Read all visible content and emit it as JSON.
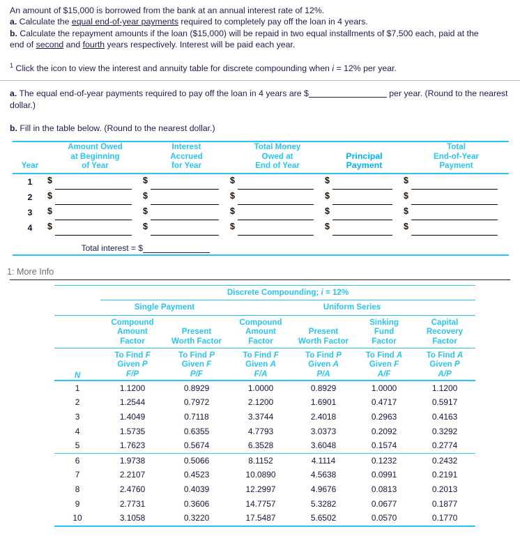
{
  "problem": {
    "intro": "An amount of $15,000 is borrowed from the bank at an annual interest rate of 12%.",
    "part_a_label": "a.",
    "part_a_pre": " Calculate the ",
    "part_a_underline": "equal end-of-year payments",
    "part_a_post": " required to completely pay off the loan in 4 years.",
    "part_b_label": "b.",
    "part_b_line1": " Calculate the repayment amounts if the loan ($15,000) will be repaid in two equal  installments of $7,500 each, paid at the",
    "part_b_line2_pre": "end of ",
    "part_b_u1": "second",
    "part_b_mid": " and ",
    "part_b_u2": "fourth",
    "part_b_line2_post": " years respectively. Interest will be paid each year."
  },
  "footnote": {
    "marker": "1",
    "text_pre": " Click the icon to view the interest and annuity table for discrete compounding when ",
    "i_symbol": "i",
    "text_post": " = 12% per year."
  },
  "answers": {
    "a_label": "a.",
    "a_text_pre": " The equal end-of-year payments required to pay off the loan in 4 years are $",
    "a_text_mid": " per year. ",
    "a_paren": "(Round to the nearest dollar.)",
    "b_label": "b.",
    "b_text": " Fill in the table below. ",
    "b_paren": "(Round to the nearest dollar.)"
  },
  "fill_table": {
    "headers": [
      "Year",
      "Amount Owed\nat Beginning\nof Year",
      "Interest\nAccrued\nfor Year",
      "Total Money\nOwed at\nEnd of Year",
      "Principal\nPayment",
      "Total\nEnd-of-Year\nPayment"
    ],
    "header_lines": {
      "year": [
        "Year"
      ],
      "amount_owed": [
        "Amount Owed",
        "at Beginning",
        "of Year"
      ],
      "interest": [
        "Interest",
        "Accrued",
        "for Year"
      ],
      "total_money": [
        "Total Money",
        "Owed at",
        "End of Year"
      ],
      "principal": [
        "Principal",
        "Payment"
      ],
      "total_payment": [
        "Total",
        "End-of-Year",
        "Payment"
      ]
    },
    "rows": [
      {
        "year": "1",
        "values": [
          "",
          "",
          "",
          "",
          ""
        ]
      },
      {
        "year": "2",
        "values": [
          "",
          "",
          "",
          "",
          ""
        ]
      },
      {
        "year": "3",
        "values": [
          "",
          "",
          "",
          "",
          ""
        ]
      },
      {
        "year": "4",
        "values": [
          "",
          "",
          "",
          "",
          ""
        ]
      }
    ],
    "currency_symbol": "$",
    "total_label": "Total interest = $",
    "total_value": ""
  },
  "more_info": {
    "label": "1: More Info"
  },
  "chart_data": {
    "type": "table",
    "title": "Discrete Compounding;",
    "title_i": "i",
    "title_rate": " = 12%",
    "group_headers": [
      "Single Payment",
      "Uniform Series"
    ],
    "column_titles": [
      [
        "Compound",
        "Amount",
        "Factor"
      ],
      [
        "Present",
        "Worth Factor"
      ],
      [
        "Compound",
        "Amount",
        "Factor"
      ],
      [
        "Present",
        "Worth Factor"
      ],
      [
        "Sinking",
        "Fund",
        "Factor"
      ],
      [
        "Capital",
        "Recovery",
        "Factor"
      ]
    ],
    "find_given": [
      [
        "To Find ",
        "F",
        "Given ",
        "P",
        "F/P"
      ],
      [
        "To Find ",
        "P",
        "Given ",
        "F",
        "P/F"
      ],
      [
        "To Find ",
        "F",
        "Given ",
        "A",
        "F/A"
      ],
      [
        "To Find ",
        "P",
        "Given ",
        "A",
        "P/A"
      ],
      [
        "To Find ",
        "A",
        "Given ",
        "F",
        "A/F"
      ],
      [
        "To Find ",
        "A",
        "Given ",
        "P",
        "A/P"
      ]
    ],
    "n_label": "N",
    "categories": [
      "1",
      "2",
      "3",
      "4",
      "5",
      "6",
      "7",
      "8",
      "9",
      "10"
    ],
    "series": [
      {
        "name": "F/P",
        "values": [
          "1.1200",
          "1.2544",
          "1.4049",
          "1.5735",
          "1.7623",
          "1.9738",
          "2.2107",
          "2.4760",
          "2.7731",
          "3.1058"
        ]
      },
      {
        "name": "P/F",
        "values": [
          "0.8929",
          "0.7972",
          "0.7118",
          "0.6355",
          "0.5674",
          "0.5066",
          "0.4523",
          "0.4039",
          "0.3606",
          "0.3220"
        ]
      },
      {
        "name": "F/A",
        "values": [
          "1.0000",
          "2.1200",
          "3.3744",
          "4.7793",
          "6.3528",
          "8.1152",
          "10.0890",
          "12.2997",
          "14.7757",
          "17.5487"
        ]
      },
      {
        "name": "P/A",
        "values": [
          "0.8929",
          "1.6901",
          "2.4018",
          "3.0373",
          "3.6048",
          "4.1114",
          "4.5638",
          "4.9676",
          "5.3282",
          "5.6502"
        ]
      },
      {
        "name": "A/F",
        "values": [
          "1.0000",
          "0.4717",
          "0.2963",
          "0.2092",
          "0.1574",
          "0.1232",
          "0.0991",
          "0.0813",
          "0.0677",
          "0.0570"
        ]
      },
      {
        "name": "A/P",
        "values": [
          "1.1200",
          "0.5917",
          "0.4163",
          "0.3292",
          "0.2774",
          "0.2432",
          "0.2191",
          "0.2013",
          "0.1877",
          "0.1770"
        ]
      }
    ]
  },
  "colors": {
    "accent_cyan": "#2ac4f0",
    "text_navy": "#1c1c4e",
    "gray_label": "#6f6f6f"
  }
}
